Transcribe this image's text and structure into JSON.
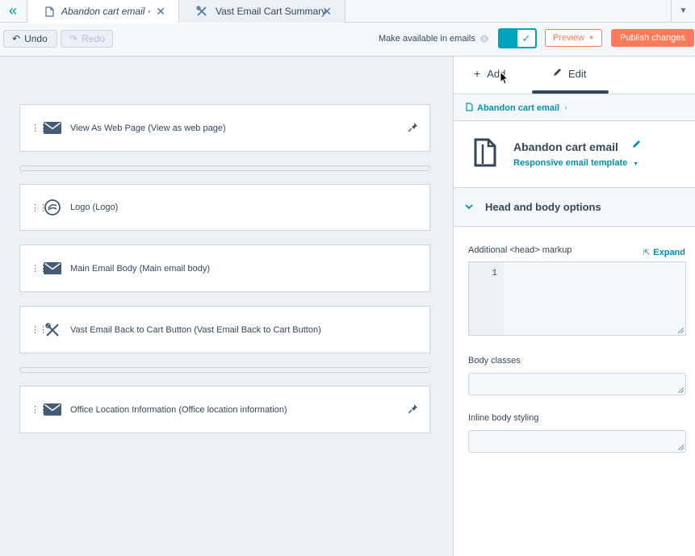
{
  "tabs": [
    {
      "label": "Abandon cart email",
      "icon": "document-icon",
      "unsaved_marker": "•"
    },
    {
      "label": "Vast Email Cart Summary",
      "icon": "tools-icon"
    }
  ],
  "toolbar": {
    "undo_label": "Undo",
    "redo_label": "Redo",
    "available_label": "Make available in emails",
    "available_enabled": true,
    "preview_label": "Preview",
    "publish_label": "Publish changes"
  },
  "modules": [
    {
      "label": "View As Web Page (View as web page)",
      "icon": "envelope-icon",
      "pinned": true
    },
    {
      "label": "Logo (Logo)",
      "icon": "logo-icon",
      "pinned": false
    },
    {
      "label": "Main Email Body (Main email body)",
      "icon": "envelope-icon",
      "pinned": false
    },
    {
      "label": "Vast Email Back to Cart Button (Vast Email Back to Cart Button)",
      "icon": "tools-icon",
      "pinned": false
    },
    {
      "label": "Office Location Information (Office location information)",
      "icon": "envelope-icon",
      "pinned": true
    }
  ],
  "panel": {
    "tab_add": "Add",
    "tab_edit": "Edit",
    "active_tab": "Edit",
    "breadcrumb": "Abandon cart email",
    "title": "Abandon cart email",
    "template_label": "Responsive email template",
    "section_label": "Head and body options",
    "head_markup_label": "Additional <head> markup",
    "expand_label": "Expand",
    "line_number": "1",
    "body_classes_label": "Body classes",
    "inline_styling_label": "Inline body styling"
  },
  "colors": {
    "accent": "#0091ae",
    "cta": "#ff7a59",
    "toggle": "#00a4bd"
  }
}
